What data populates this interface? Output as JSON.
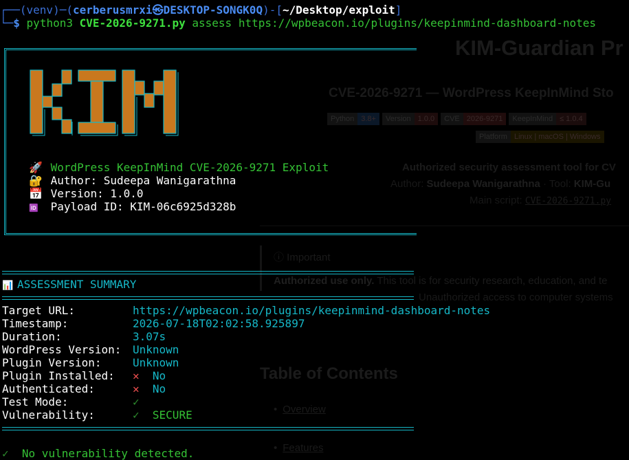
{
  "prompt": {
    "open": "┌──(",
    "env": "venv",
    "sep1": ")─(",
    "user": "cerberusmrxi",
    "at": "㉿",
    "host": "DESKTOP-SONGK0Q",
    "sep2": ")-[",
    "path": "~/Desktop/exploit",
    "close": "]",
    "corner": "└─",
    "dollar": "$",
    "cmd": "python3",
    "script": "CVE-2026-9271.py",
    "args": "assess https://wpbeacon.io/plugins/keepinmind-dashboard-notes"
  },
  "banner": {
    "logo": "KIM",
    "title": "WordPress KeepInMind CVE-2026-9271 Exploit",
    "author": "Author: Sudeepa Wanigarathna",
    "version": "Version: 1.0.0",
    "payload": "Payload ID: KIM-06c6925d328b",
    "icons": [
      "rocket-icon",
      "lock-key-icon",
      "calendar-icon",
      "id-icon"
    ]
  },
  "summary": {
    "heading": "ASSESSMENT SUMMARY",
    "rows": [
      {
        "label": "Target URL:",
        "value": "https://wpbeacon.io/plugins/keepinmind-dashboard-notes"
      },
      {
        "label": "Timestamp:",
        "value": "2026-07-18T02:02:58.925897"
      },
      {
        "label": "Duration:",
        "value": "3.07s"
      },
      {
        "label": "WordPress Version:",
        "value": "Unknown"
      },
      {
        "label": "Plugin Version:",
        "value": "Unknown"
      },
      {
        "label": "Plugin Installed:",
        "value": "No"
      },
      {
        "label": "Authenticated:",
        "value": "No"
      },
      {
        "label": "Test Mode:",
        "value": ""
      },
      {
        "label": "Vulnerability:",
        "value": "SECURE"
      }
    ],
    "rule": "==========================================================================================",
    "result": "No vulnerability detected."
  },
  "readme": {
    "title": "KIM-Guardian Pr",
    "subtitle": "CVE-2026-9271 — WordPress KeepInMind Sto",
    "badges_row1": [
      {
        "k": "Python",
        "v": "3.8+"
      },
      {
        "k": "Version",
        "v": "1.0.0"
      },
      {
        "k": "CVE",
        "v": "2026-9271"
      },
      {
        "k": "KeepInMind",
        "v": "≤ 1.0.4"
      }
    ],
    "badges_row2": [
      {
        "k": "Platform",
        "v": "Linux | macOS | Windows"
      }
    ],
    "tagline": "Authorized security assessment tool for CV",
    "author_prefix": "Author:",
    "author_name": "Sudeepa Wanigarathna",
    "tool_prefix": "· Tool:",
    "tool_name": "KIM-Gu",
    "main_script": "Main script:",
    "main_script_value": "CVE-2026-9271.py",
    "important": "Important",
    "authorized": "Authorized use only.",
    "authorized_rest": "This tool is for security research, education, and te",
    "unauthorized": "Unauthorized access to computer systems",
    "toc": "Table of Contents",
    "toc_items": [
      "Overview",
      "Features"
    ]
  },
  "colors": {
    "cyan": "#16b8c8",
    "green": "#35c235",
    "blue": "#3b6fd6",
    "logo_orange": "#c9781e",
    "logo_outline": "#16b8c8"
  }
}
